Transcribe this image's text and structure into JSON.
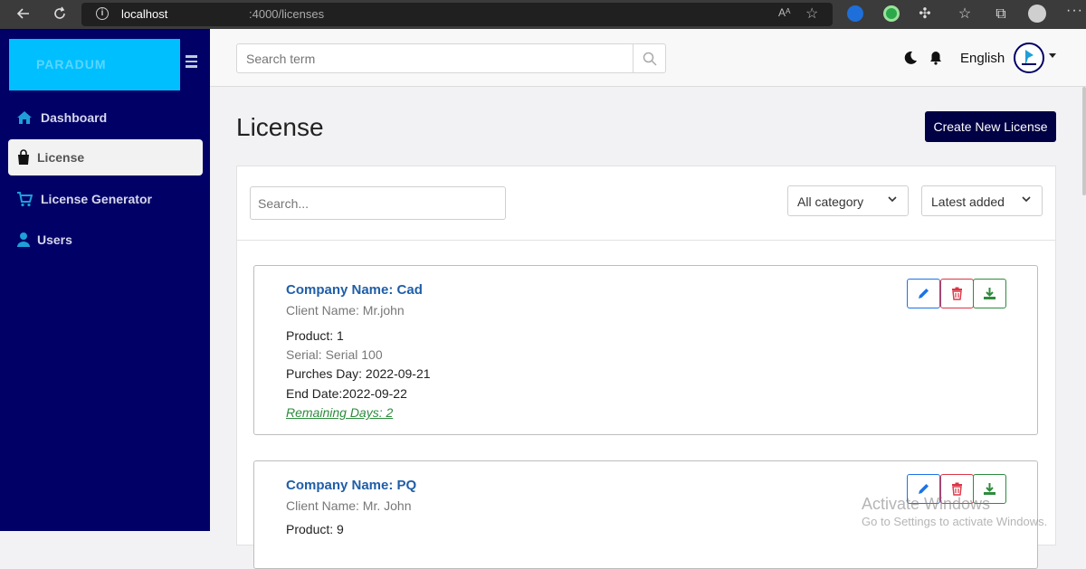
{
  "browser": {
    "url_host": "localhost",
    "url_path": ":4000/licenses",
    "read_aloud": "Aᴬ"
  },
  "sidebar": {
    "logo_text": "PARADUM",
    "items": [
      {
        "label": "Dashboard",
        "icon": "home-icon",
        "active": false
      },
      {
        "label": "License",
        "icon": "bag-icon",
        "active": true
      },
      {
        "label": "License Generator",
        "icon": "cart-icon",
        "active": false
      },
      {
        "label": "Users",
        "icon": "user-icon",
        "active": false
      }
    ]
  },
  "topbar": {
    "search_placeholder": "Search term",
    "language": "English"
  },
  "main": {
    "title": "License",
    "create_label": "Create New License",
    "search_placeholder": "Search...",
    "category_select": "All category",
    "sort_select": "Latest added"
  },
  "licenses": [
    {
      "company": "Company Name: Cad",
      "client": "Client Name: Mr.john",
      "product": "Product: 1",
      "serial": "Serial: Serial 100",
      "purchase": "Purches Day: 2022-09-21",
      "end": "End Date:2022-09-22",
      "remaining": "Remaining Days: 2"
    },
    {
      "company": "Company Name: PQ",
      "client": "Client Name: Mr. John",
      "product": "Product: 9"
    }
  ],
  "watermark": {
    "line1": "Activate Windows",
    "line2": "Go to Settings to activate Windows."
  },
  "colors": {
    "sidebar_bg": "#000066",
    "logo_bg": "#00bfff",
    "primary_button": "#000044",
    "company_text": "#1f5ea8",
    "remaining_text": "#2e8b3d",
    "edit": "#1a73e8",
    "delete": "#dc3545",
    "download": "#2e8b3d"
  }
}
